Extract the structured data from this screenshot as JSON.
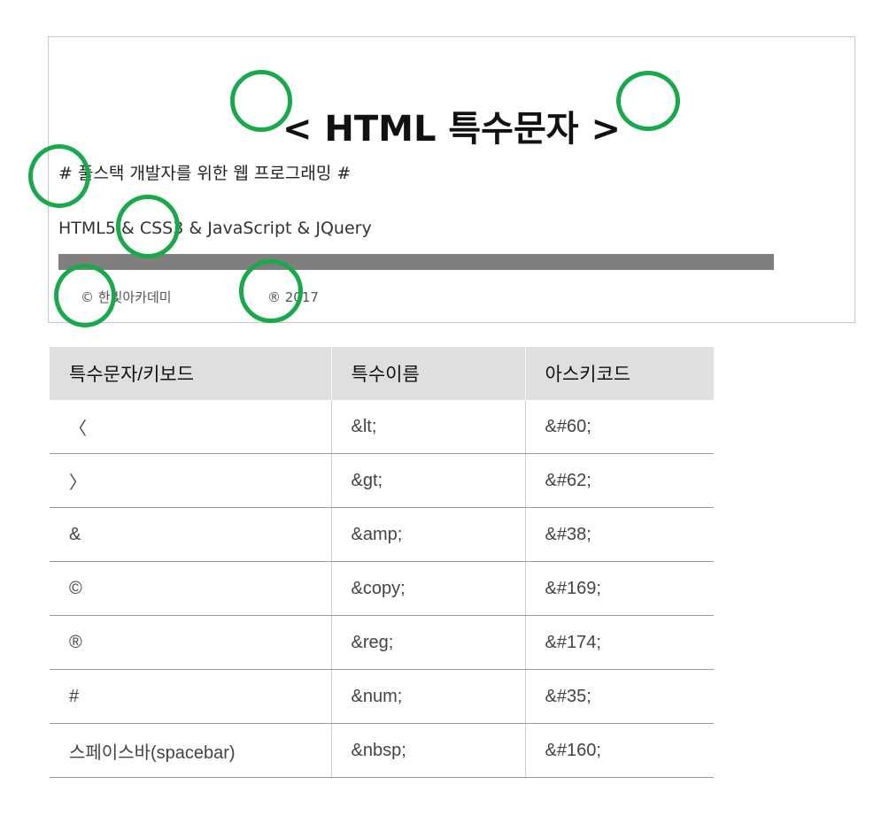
{
  "demo": {
    "title_left": "<",
    "title_main": "HTML 특수문자",
    "title_right": ">",
    "subtitle": "# 풀스택 개발자를 위한 웹 프로그래밍 #",
    "tech": "HTML5 & CSS3 & JavaScript & JQuery",
    "copyright": "© 한빛아카데미",
    "registered": "® 2017",
    "highlight_color": "#19a84a",
    "bar_color": "#7f7f7f"
  },
  "table": {
    "headers": [
      "특수문자/키보드",
      "특수이름",
      "아스키코드"
    ],
    "rows": [
      [
        "〈",
        "&lt;",
        "&#60;"
      ],
      [
        "〉",
        "&gt;",
        "&#62;"
      ],
      [
        "&",
        "&amp;",
        "&#38;"
      ],
      [
        "©",
        "&copy;",
        "&#169;"
      ],
      [
        "®",
        "&reg;",
        "&#174;"
      ],
      [
        "#",
        "&num;",
        "&#35;"
      ],
      [
        "스페이스바(spacebar)",
        "&nbsp;",
        "&#160;"
      ]
    ]
  }
}
